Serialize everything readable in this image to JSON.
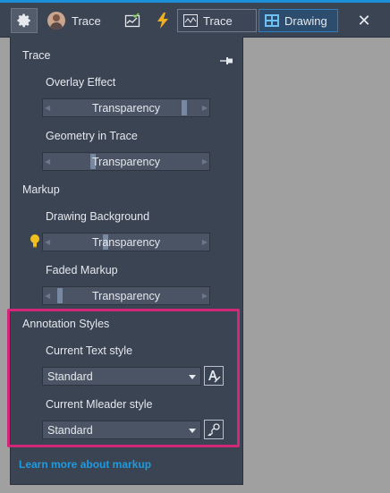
{
  "toolbar": {
    "trace_label": "Trace",
    "tabs": [
      {
        "label": "Trace",
        "icon": "trace-waveform-icon"
      },
      {
        "label": "Drawing",
        "icon": "drawing-grid-icon"
      }
    ],
    "close_glyph": "✕",
    "icons": [
      "gear-icon",
      "avatar",
      "chart-check-icon",
      "lightning-bolt-icon",
      "close-icon"
    ]
  },
  "panel": {
    "sections": {
      "trace": {
        "title": "Trace",
        "items": [
          {
            "label": "Overlay Effect",
            "slider_text": "Transparency",
            "value": 0.84
          },
          {
            "label": "Geometry in Trace",
            "slider_text": "Transparency",
            "value": 0.3
          }
        ]
      },
      "markup": {
        "title": "Markup",
        "items": [
          {
            "label": "Drawing Background",
            "slider_text": "Transparency",
            "value": 0.37
          },
          {
            "label": "Faded Markup",
            "slider_text": "Transparency",
            "value": 0.1
          }
        ]
      },
      "annotation": {
        "title": "Annotation Styles",
        "text_style_label": "Current Text style",
        "text_style_value": "Standard",
        "mleader_style_label": "Current Mleader style",
        "mleader_style_value": "Standard"
      }
    },
    "link": "Learn more about markup"
  },
  "colors": {
    "accent_blue": "#1b8fd8",
    "panel_bg": "#3b4453",
    "highlight": "#d2287a",
    "link": "#1e9be0"
  }
}
